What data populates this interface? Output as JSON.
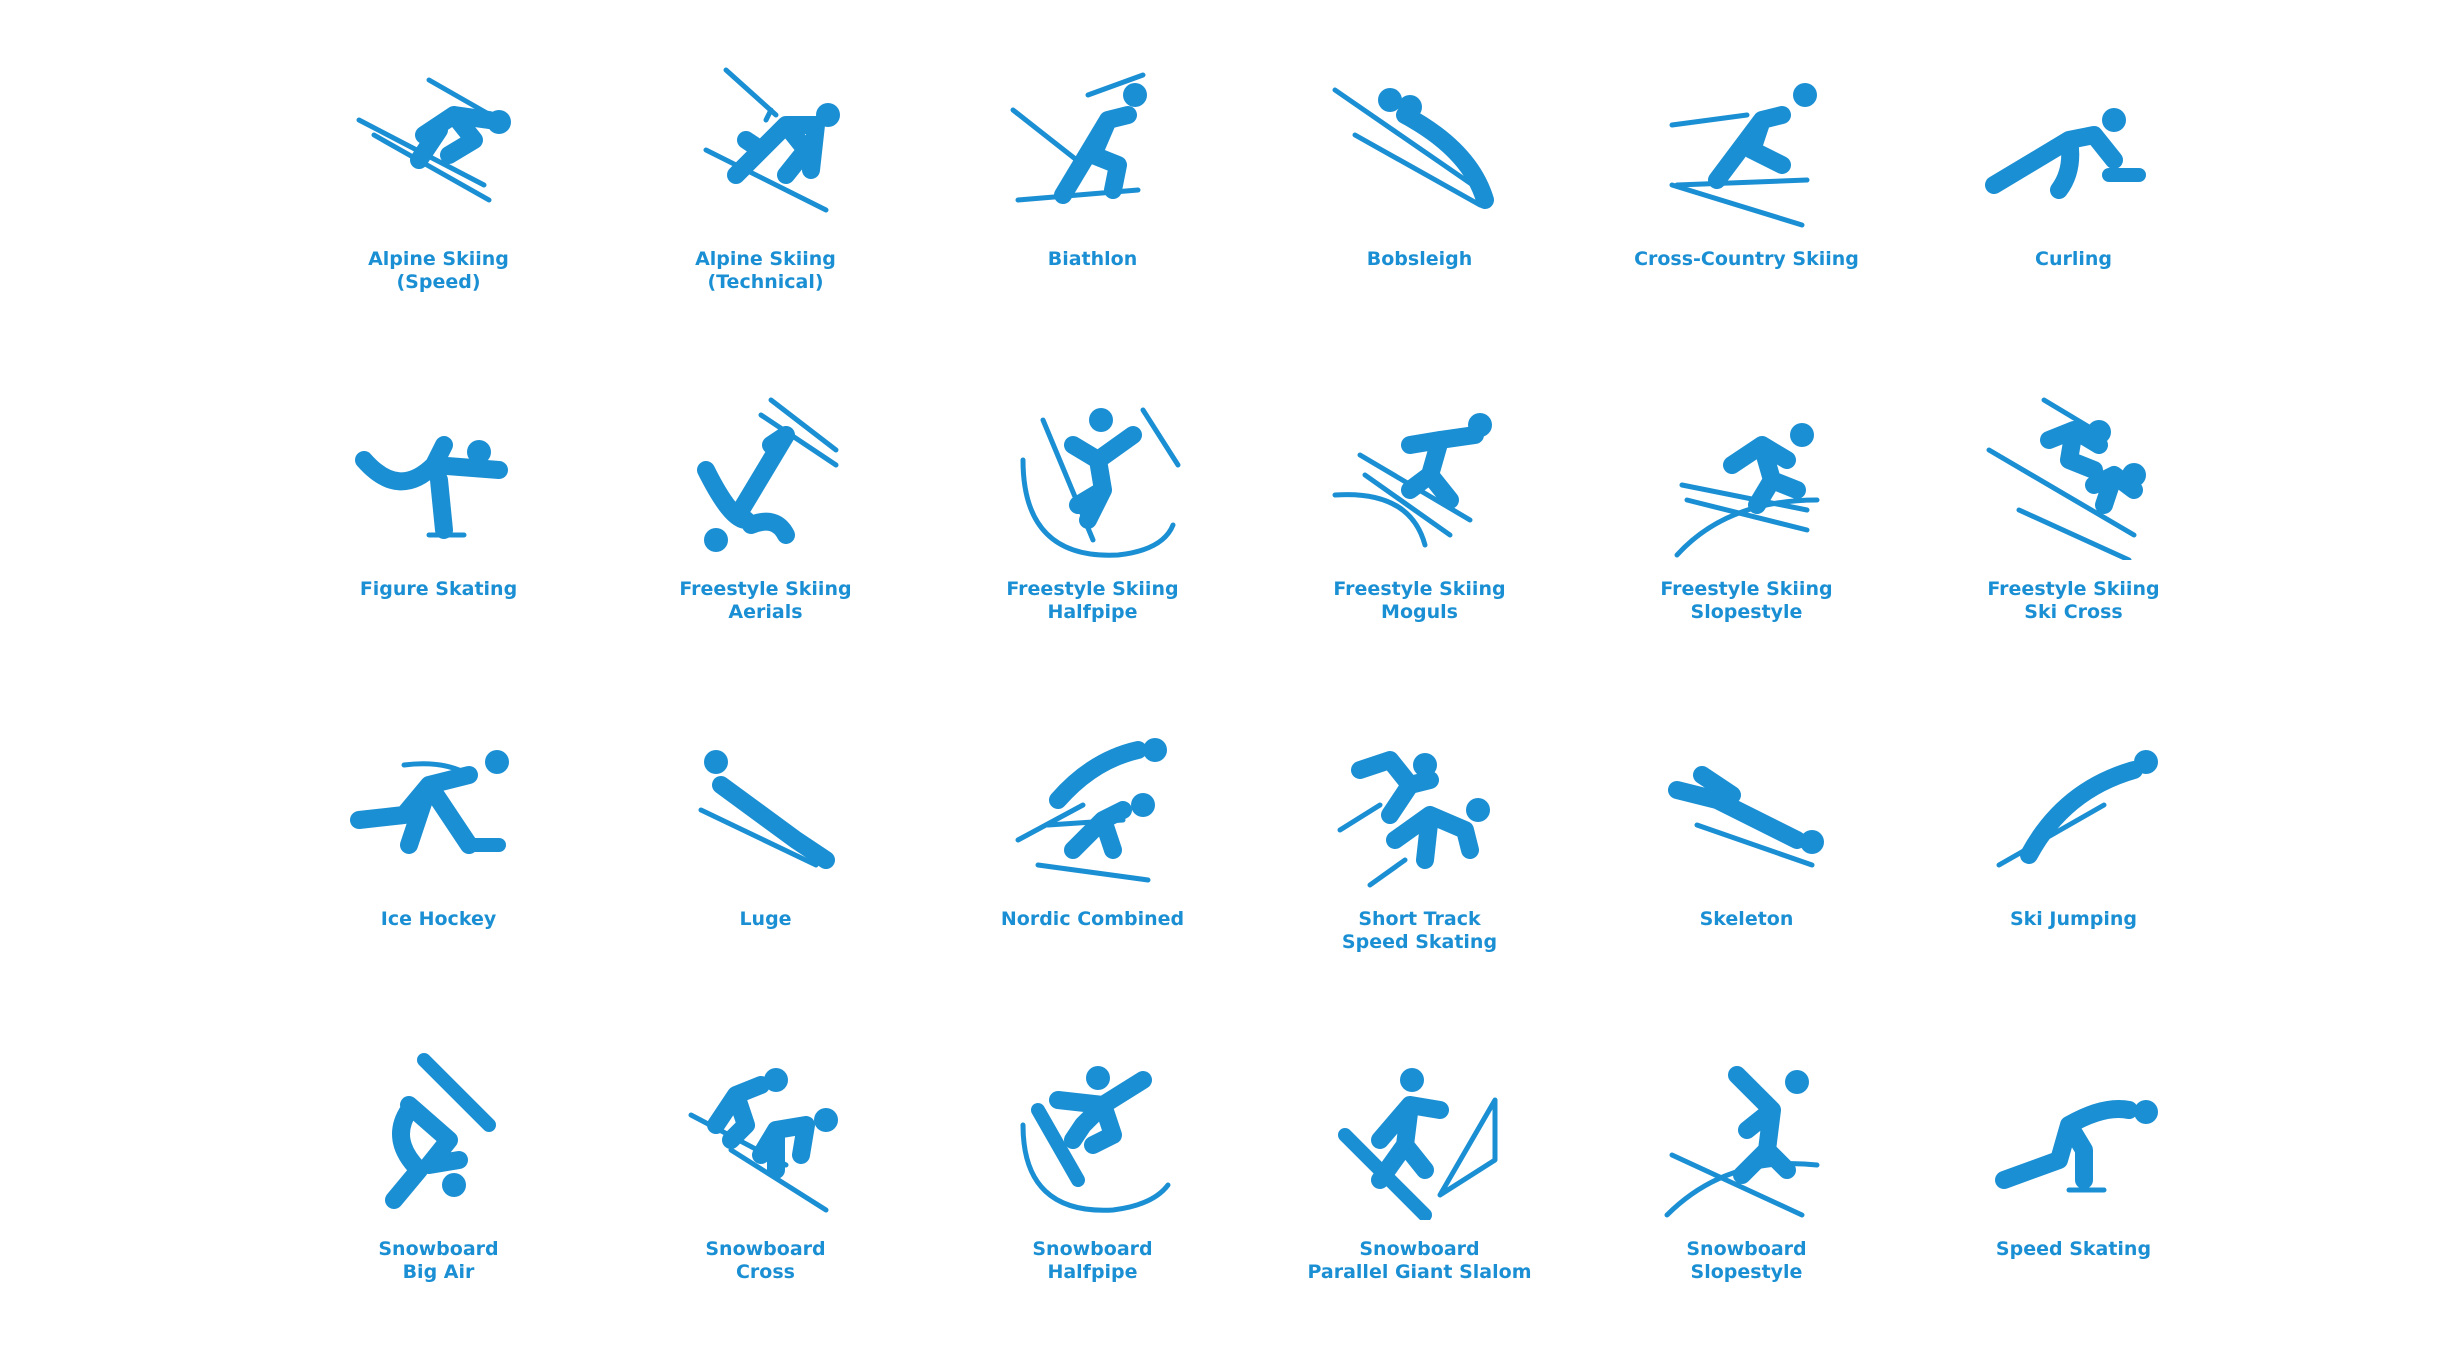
{
  "accent_color": "#1b8fd3",
  "pictograms": [
    {
      "icon": "alpine-skiing-speed-icon",
      "line1": "Alpine Skiing",
      "line2": "(Speed)"
    },
    {
      "icon": "alpine-skiing-technical-icon",
      "line1": "Alpine Skiing",
      "line2": "(Technical)"
    },
    {
      "icon": "biathlon-icon",
      "line1": "Biathlon",
      "line2": ""
    },
    {
      "icon": "bobsleigh-icon",
      "line1": "Bobsleigh",
      "line2": ""
    },
    {
      "icon": "cross-country-skiing-icon",
      "line1": "Cross-Country Skiing",
      "line2": ""
    },
    {
      "icon": "curling-icon",
      "line1": "Curling",
      "line2": ""
    },
    {
      "icon": "figure-skating-icon",
      "line1": "Figure Skating",
      "line2": ""
    },
    {
      "icon": "freestyle-skiing-aerials-icon",
      "line1": "Freestyle Skiing",
      "line2": "Aerials"
    },
    {
      "icon": "freestyle-skiing-halfpipe-icon",
      "line1": "Freestyle Skiing",
      "line2": "Halfpipe"
    },
    {
      "icon": "freestyle-skiing-moguls-icon",
      "line1": "Freestyle Skiing",
      "line2": "Moguls"
    },
    {
      "icon": "freestyle-skiing-slopestyle-icon",
      "line1": "Freestyle Skiing",
      "line2": "Slopestyle"
    },
    {
      "icon": "freestyle-skiing-ski-cross-icon",
      "line1": "Freestyle Skiing",
      "line2": "Ski Cross"
    },
    {
      "icon": "ice-hockey-icon",
      "line1": "Ice Hockey",
      "line2": ""
    },
    {
      "icon": "luge-icon",
      "line1": "Luge",
      "line2": ""
    },
    {
      "icon": "nordic-combined-icon",
      "line1": "Nordic Combined",
      "line2": ""
    },
    {
      "icon": "short-track-speed-skating-icon",
      "line1": "Short Track",
      "line2": "Speed Skating"
    },
    {
      "icon": "skeleton-icon",
      "line1": "Skeleton",
      "line2": ""
    },
    {
      "icon": "ski-jumping-icon",
      "line1": "Ski Jumping",
      "line2": ""
    },
    {
      "icon": "snowboard-big-air-icon",
      "line1": "Snowboard",
      "line2": "Big Air"
    },
    {
      "icon": "snowboard-cross-icon",
      "line1": "Snowboard",
      "line2": "Cross"
    },
    {
      "icon": "snowboard-halfpipe-icon",
      "line1": "Snowboard",
      "line2": "Halfpipe"
    },
    {
      "icon": "snowboard-parallel-giant-slalom-icon",
      "line1": "Snowboard",
      "line2": "Parallel Giant Slalom"
    },
    {
      "icon": "snowboard-slopestyle-icon",
      "line1": "Snowboard",
      "line2": "Slopestyle"
    },
    {
      "icon": "speed-skating-icon",
      "line1": "Speed Skating",
      "line2": ""
    }
  ]
}
